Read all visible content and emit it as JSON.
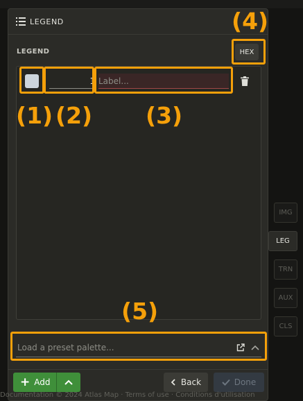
{
  "header": {
    "title": "LEGEND"
  },
  "section": {
    "label": "LEGEND",
    "hex_button": "HEX"
  },
  "legend_row": {
    "swatch_color": "#cdd5dc",
    "value": "1",
    "label_placeholder": "Label..."
  },
  "preset": {
    "placeholder": "Load a preset palette..."
  },
  "footer": {
    "add_label": "Add",
    "back_label": "Back",
    "done_label": "Done"
  },
  "side_tabs": [
    "IMG",
    "LEG",
    "TRN",
    "AUX",
    "CLS"
  ],
  "active_tab": "LEG",
  "bottom_text": "Documentation © 2024 Atlas Map · Terms of use · Conditions d'utilisation",
  "annotations": [
    "(1)",
    "(2)",
    "(3)",
    "(4)",
    "(5)"
  ],
  "colors": {
    "annotation": "#f5a00a",
    "add_button": "#3f8f3a",
    "panel": "#2b2b27"
  }
}
